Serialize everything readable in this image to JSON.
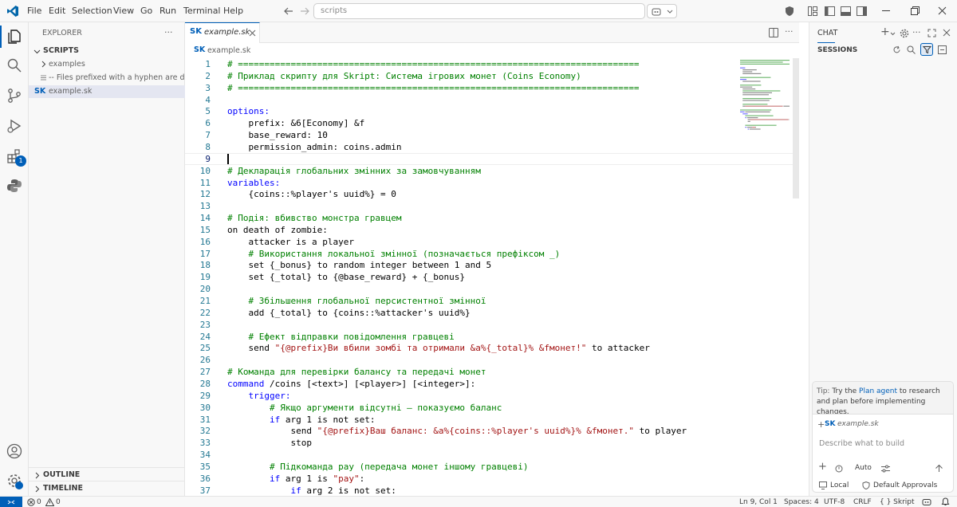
{
  "titlebar": {
    "menus": [
      "File",
      "Edit",
      "Selection",
      "View",
      "Go",
      "Run",
      "Terminal",
      "Help"
    ],
    "search_placeholder": "scripts"
  },
  "sidebar": {
    "header": "EXPLORER",
    "root": "SCRIPTS",
    "items": [
      {
        "label": "examples",
        "type": "folder"
      },
      {
        "label": "-- Files prefixed with a hyphen are dis...",
        "type": "file"
      },
      {
        "label": "example.sk",
        "type": "file",
        "icon": "SK"
      }
    ],
    "outline": "OUTLINE",
    "timeline": "TIMELINE",
    "badge": "1"
  },
  "editor": {
    "tab_label": "example.sk",
    "tab_icon": "SK",
    "breadcrumb": "example.sk",
    "lines": [
      [
        {
          "t": "# ============================================================================",
          "c": "com"
        }
      ],
      [
        {
          "t": "# Приклад скрипту для Skript: Система ігрових монет (Coins Economy)",
          "c": "com"
        }
      ],
      [
        {
          "t": "# ============================================================================",
          "c": "com"
        }
      ],
      [],
      [
        {
          "t": "options:",
          "c": "kw"
        }
      ],
      [
        {
          "t": "    prefix: &6[Economy] &f",
          "c": "def"
        }
      ],
      [
        {
          "t": "    base_reward: 10",
          "c": "def"
        }
      ],
      [
        {
          "t": "    permission_admin: coins.admin",
          "c": "def"
        }
      ],
      [],
      [
        {
          "t": "# Декларація глобальних змінних за замовчуванням",
          "c": "com"
        }
      ],
      [
        {
          "t": "variables:",
          "c": "kw"
        }
      ],
      [
        {
          "t": "    {coins::%player's uuid%} = 0",
          "c": "def"
        }
      ],
      [],
      [
        {
          "t": "# Подія: вбивство монстра гравцем",
          "c": "com"
        }
      ],
      [
        {
          "t": "on death of zombie:",
          "c": "def"
        }
      ],
      [
        {
          "t": "    attacker is a player",
          "c": "def"
        }
      ],
      [
        {
          "t": "    # Використання локальної змінної (позначається префіксом _)",
          "c": "com"
        }
      ],
      [
        {
          "t": "    set {_bonus} to random integer between 1 and 5",
          "c": "def"
        }
      ],
      [
        {
          "t": "    set {_total} to {@base_reward} + {_bonus}",
          "c": "def"
        }
      ],
      [],
      [
        {
          "t": "    # Збільшення глобальної персистентної змінної",
          "c": "com"
        }
      ],
      [
        {
          "t": "    add {_total} to {coins::%attacker's uuid%}",
          "c": "def"
        }
      ],
      [],
      [
        {
          "t": "    # Ефект відправки повідомлення гравцеві",
          "c": "com"
        }
      ],
      [
        {
          "t": "    send ",
          "c": "def"
        },
        {
          "t": "\"{@prefix}Ви вбили зомбі та отримали &a%{_total}% &fмонет!\"",
          "c": "str"
        },
        {
          "t": " to attacker",
          "c": "def"
        }
      ],
      [],
      [
        {
          "t": "# Команда для перевірки балансу та передачі монет",
          "c": "com"
        }
      ],
      [
        {
          "t": "command",
          "c": "kw"
        },
        {
          "t": " /coins [<text>] [<player>] [<integer>]:",
          "c": "def"
        }
      ],
      [
        {
          "t": "    trigger:",
          "c": "kw"
        }
      ],
      [
        {
          "t": "        # Якщо аргументи відсутні — показуємо баланс",
          "c": "com"
        }
      ],
      [
        {
          "t": "        if",
          "c": "kw"
        },
        {
          "t": " arg 1 is not set:",
          "c": "def"
        }
      ],
      [
        {
          "t": "            send ",
          "c": "def"
        },
        {
          "t": "\"{@prefix}Ваш баланс: &a%{coins::%player's uuid%}% &fмонет.\"",
          "c": "str"
        },
        {
          "t": " to player",
          "c": "def"
        }
      ],
      [
        {
          "t": "            stop",
          "c": "def"
        }
      ],
      [],
      [
        {
          "t": "        # Підкоманда pay (передача монет іншому гравцеві)",
          "c": "com"
        }
      ],
      [
        {
          "t": "        if",
          "c": "kw"
        },
        {
          "t": " arg 1 is ",
          "c": "def"
        },
        {
          "t": "\"pay\"",
          "c": "str"
        },
        {
          "t": ":",
          "c": "def"
        }
      ],
      [
        {
          "t": "            if",
          "c": "kw"
        },
        {
          "t": " arg 2 is not set:",
          "c": "def"
        }
      ]
    ]
  },
  "chat": {
    "tab": "CHAT",
    "sessions": "SESSIONS",
    "tip_prefix": "Tip:",
    "tip_text": " Try the ",
    "tip_link": "Plan agent",
    "tip_rest": " to research and plan before implementing changes.",
    "attachment_icon": "SK",
    "attachment": "example.sk",
    "input_placeholder": "Describe what to build",
    "mode": "Auto",
    "local": "Local",
    "approvals": "Default Approvals"
  },
  "statusbar": {
    "errors": "0",
    "warnings": "0",
    "position": "Ln 9, Col 1",
    "spaces": "Spaces: 4",
    "encoding": "UTF-8",
    "eol": "CRLF",
    "language": "{ } Skript"
  },
  "colors": {
    "accent": "#005fb8",
    "comment": "#008000",
    "keyword": "#0000ff",
    "string": "#a31515",
    "linenum": "#237893"
  }
}
